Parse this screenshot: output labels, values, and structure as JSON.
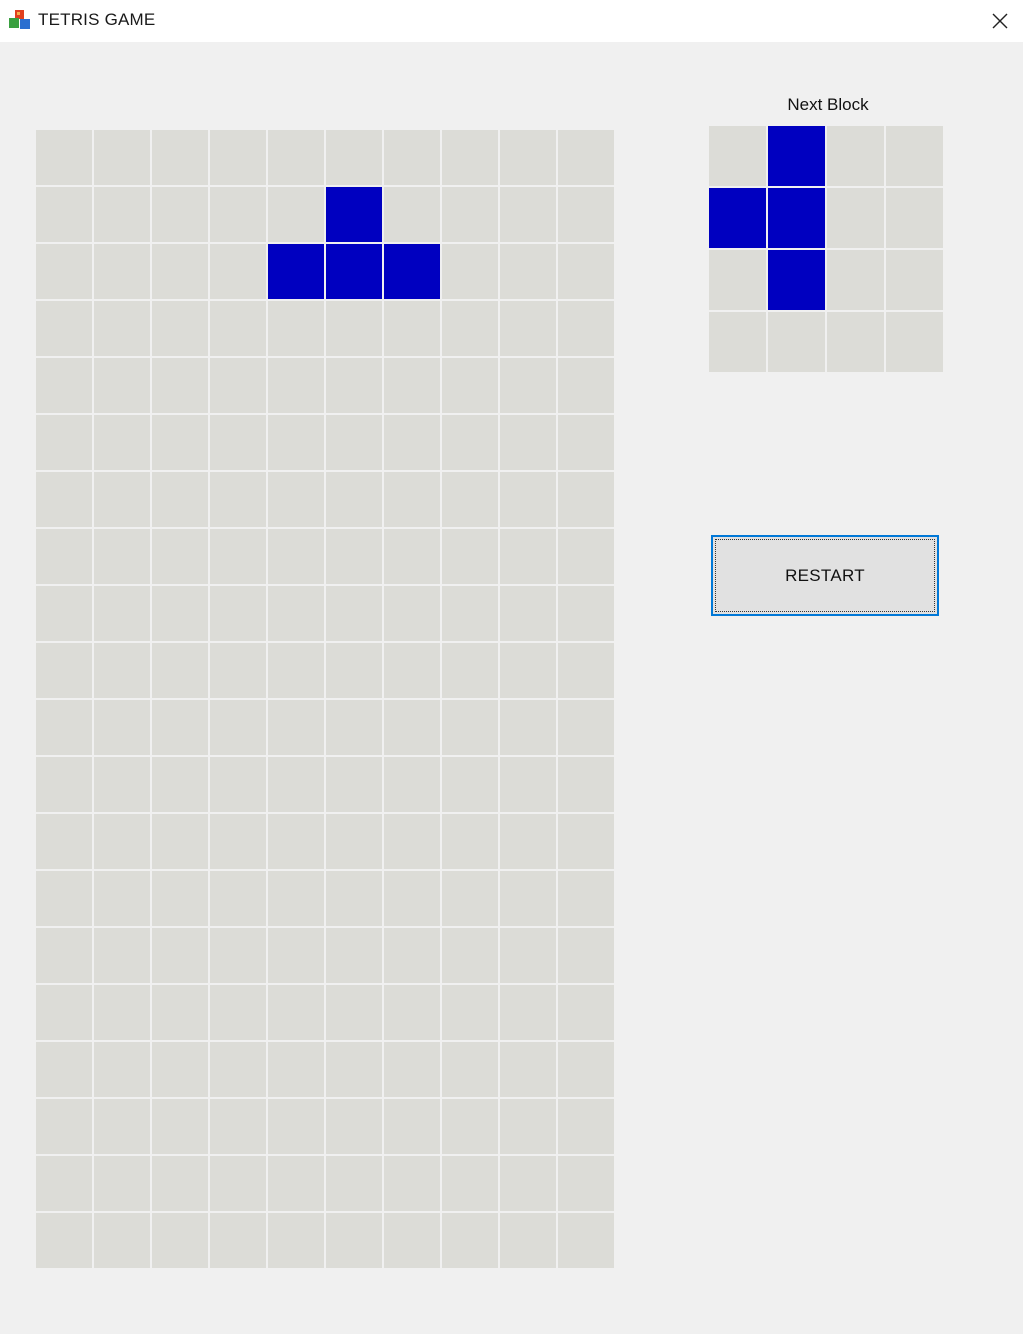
{
  "window": {
    "title": "TETRIS GAME",
    "icon": "tetris-cubes-icon",
    "close_icon": "close-icon"
  },
  "board": {
    "columns": 10,
    "rows": 20,
    "empty_color": "#dcdcd7",
    "block_color": "#0000c0",
    "filled_cells": [
      [
        1,
        5
      ],
      [
        2,
        4
      ],
      [
        2,
        5
      ],
      [
        2,
        6
      ]
    ]
  },
  "next_block": {
    "label": "Next Block",
    "columns": 4,
    "rows": 4,
    "filled_cells": [
      [
        0,
        1
      ],
      [
        1,
        0
      ],
      [
        1,
        1
      ],
      [
        2,
        1
      ]
    ]
  },
  "controls": {
    "restart_label": "RESTART",
    "focus_color": "#0078d7"
  }
}
